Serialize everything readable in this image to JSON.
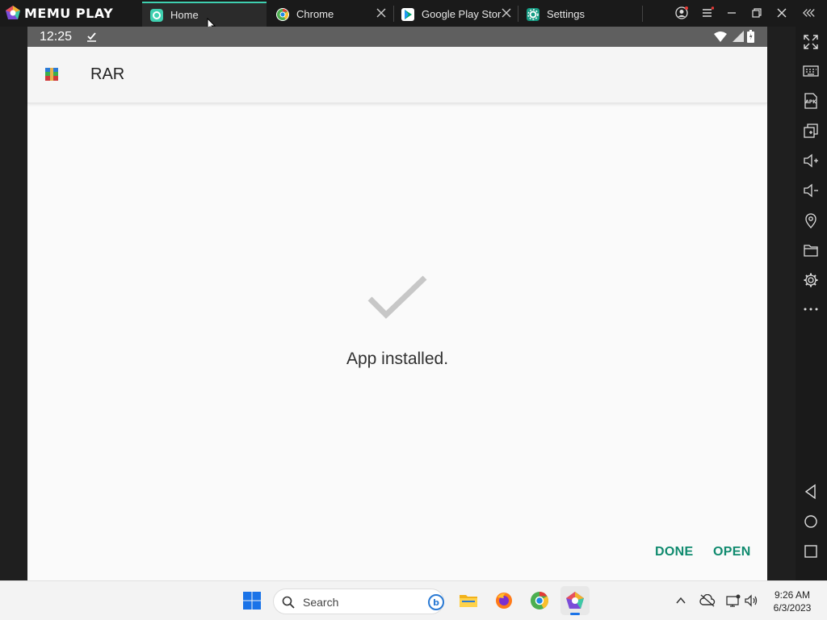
{
  "emulator": {
    "logo_text": "MEMU PLAY",
    "tabs": [
      {
        "label": "Home",
        "icon": "home-app-icon",
        "active": true
      },
      {
        "label": "Chrome",
        "icon": "chrome-icon",
        "active": false
      },
      {
        "label": "Google Play Stor",
        "icon": "play-store-icon",
        "active": false
      },
      {
        "label": "Settings",
        "icon": "settings-app-icon",
        "active": false
      }
    ],
    "accent": "#3fd0b0"
  },
  "android": {
    "status_time": "12:25",
    "app_title": "RAR",
    "message": "App installed.",
    "done_label": "DONE",
    "open_label": "OPEN",
    "button_color": "#0f8a6e"
  },
  "sidebar_icons": [
    "fullscreen-icon",
    "keyboard-icon",
    "apk-icon",
    "multi-window-icon",
    "volume-up-icon",
    "volume-down-icon",
    "location-icon",
    "folder-icon",
    "gear-icon",
    "more-icon",
    "back-icon",
    "home-icon",
    "recents-icon"
  ],
  "taskbar": {
    "search_placeholder": "Search",
    "time": "9:26 AM",
    "date": "6/3/2023"
  }
}
